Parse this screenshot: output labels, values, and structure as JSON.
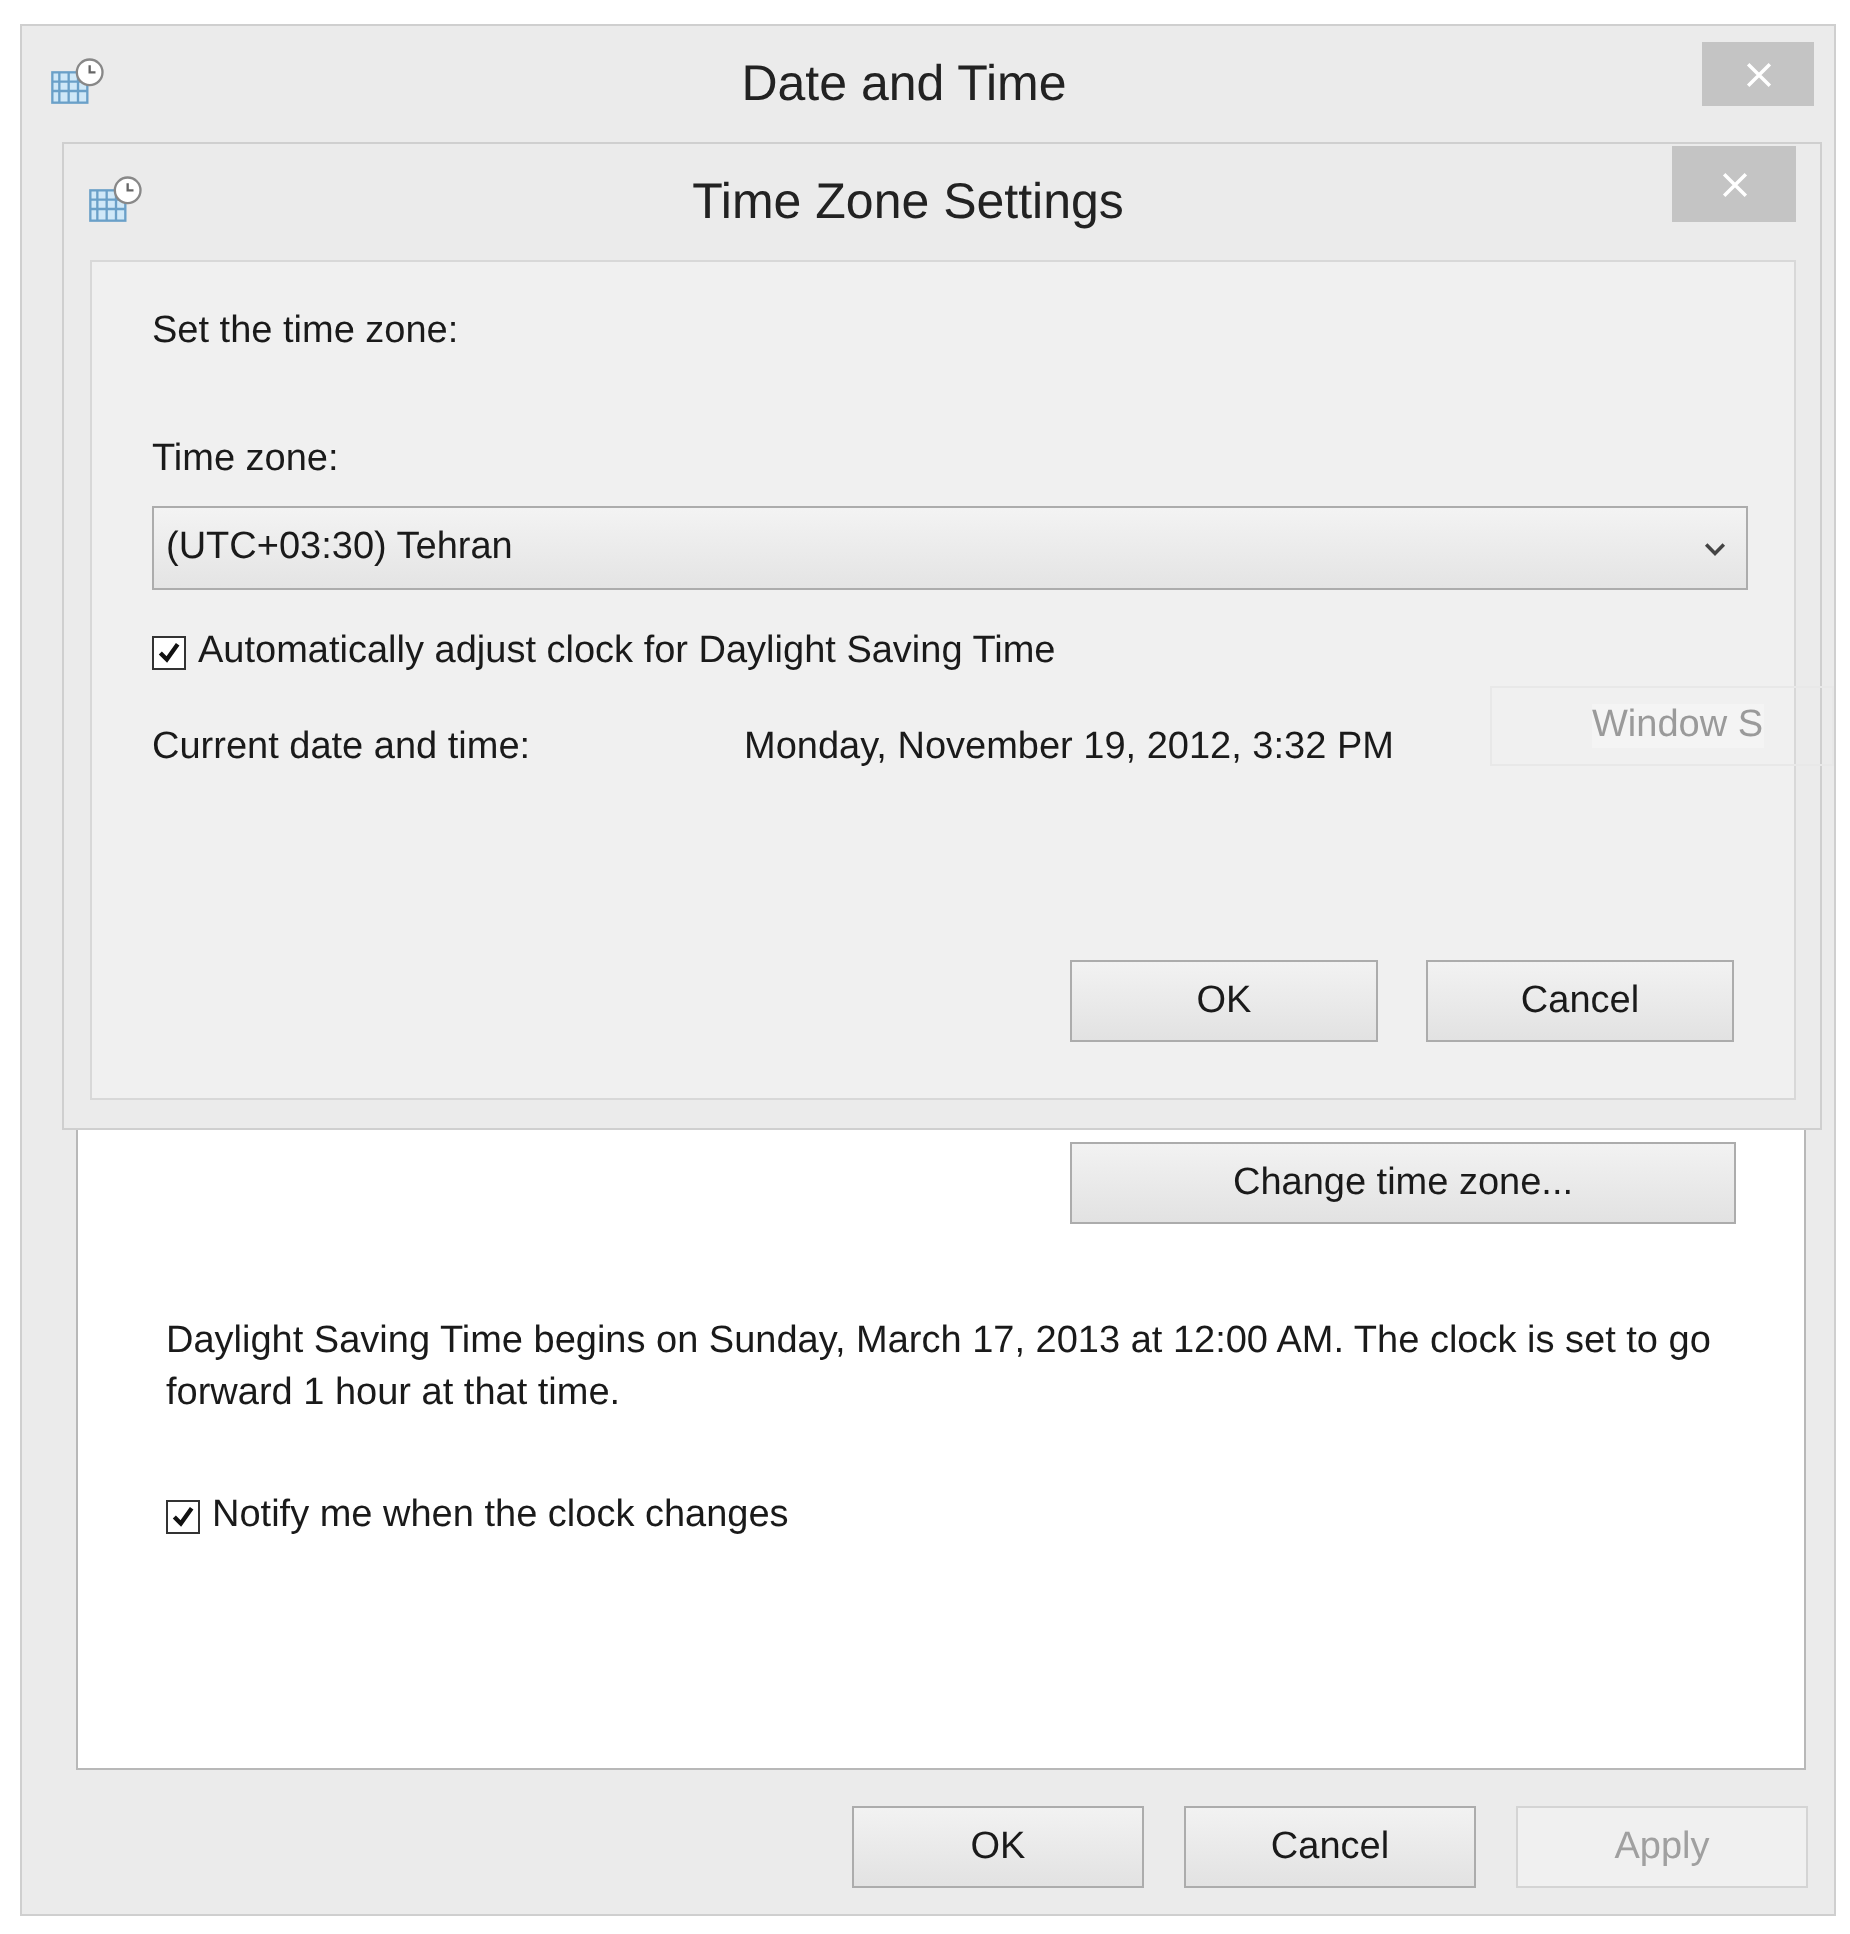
{
  "window": {
    "title": "Date and Time"
  },
  "dialog": {
    "title": "Time Zone Settings",
    "instruction": "Set the time zone:",
    "time_zone_label": "Time zone:",
    "time_zone_value": "(UTC+03:30) Tehran",
    "dst_checkbox": {
      "label": "Automatically adjust clock for Daylight Saving Time",
      "checked": true
    },
    "current_label": "Current date and time:",
    "current_value": "Monday, November 19, 2012, 3:32 PM",
    "buttons": [
      {
        "label": "OK",
        "disabled": false
      },
      {
        "label": "Cancel",
        "disabled": false
      }
    ]
  },
  "background_window": {
    "title": "Window S"
  },
  "main": {
    "change_button": "Change time zone...",
    "dst_info": "Daylight Saving Time begins on Sunday, March 17, 2013 at 12:00 AM. The clock is set to go forward 1 hour at that time.",
    "notify_checkbox": {
      "label": "Notify me when the clock changes",
      "checked": true
    }
  },
  "buttons": [
    {
      "label": "OK",
      "disabled": false
    },
    {
      "label": "Cancel",
      "disabled": false
    },
    {
      "label": "Apply",
      "disabled": true
    }
  ]
}
